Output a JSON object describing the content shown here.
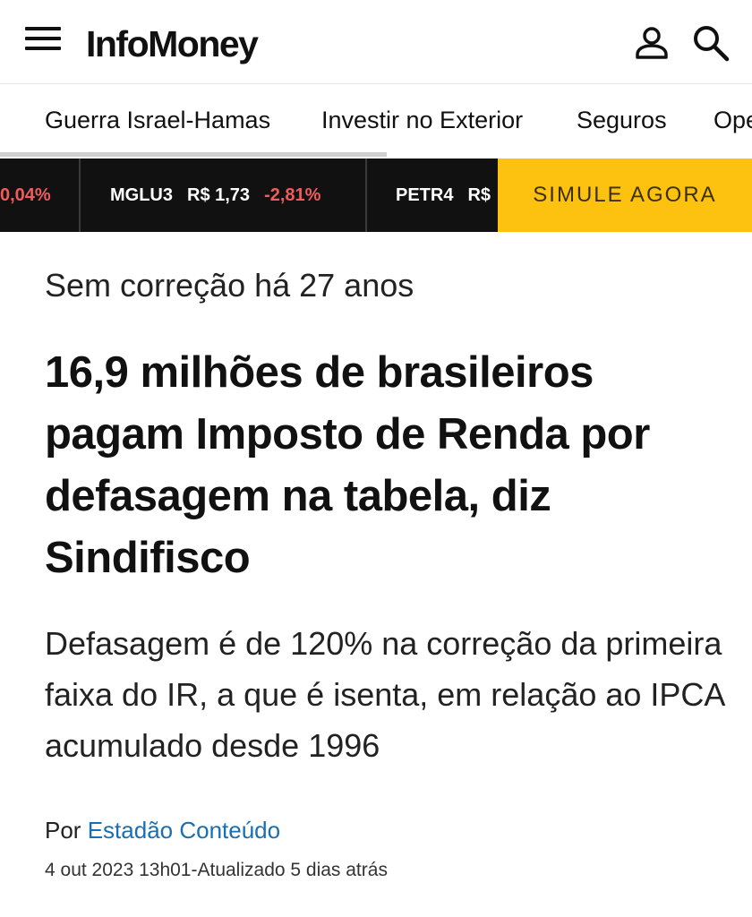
{
  "header": {
    "logo": "InfoMoney",
    "menu_icon": "hamburger-menu-icon",
    "user_icon": "user-account-icon",
    "search_icon": "search-icon"
  },
  "nav": {
    "items": [
      "Guerra Israel-Hamas",
      "Investir no Exterior",
      "Seguros",
      "Ope"
    ]
  },
  "ticker": {
    "items": [
      {
        "symbol": "",
        "price": "",
        "change": "0,04%"
      },
      {
        "symbol": "MGLU3",
        "price": "R$ 1,73",
        "change": "-2,81%"
      },
      {
        "symbol": "PETR4",
        "price": "R$",
        "change": ""
      }
    ],
    "cta_label": "SIMULE AGORA",
    "cta_color": "#fdc20f"
  },
  "article": {
    "kicker": "Sem correção há 27 anos",
    "headline": "16,9 milhões de brasileiros pagam Imposto de Renda por defasagem na tabela, diz Sindifisco",
    "subhead": "Defasagem é de 120% na correção da primeira faixa do IR, a que é isenta, em relação ao IPCA acumulado desde 1996",
    "byline_prefix": "Por",
    "author": "Estadão Conteúdo",
    "author_color": "#1a6fb0",
    "date": "4 out 2023 13h01-Atualizado 5 dias atrás"
  }
}
